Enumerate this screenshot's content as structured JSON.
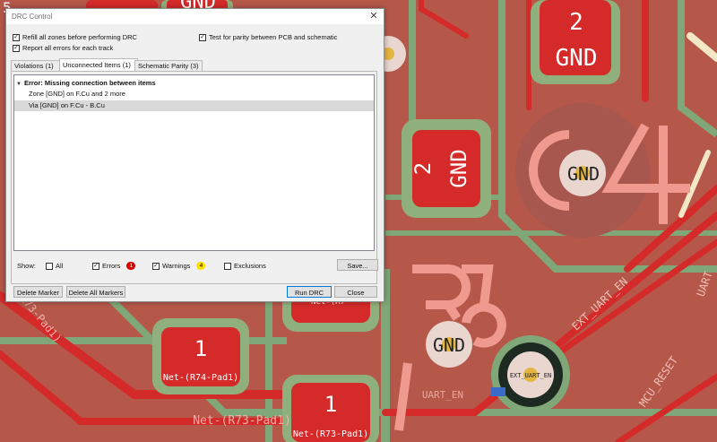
{
  "dialog": {
    "title": "DRC Control",
    "close_glyph": "✕",
    "options": {
      "refill_zones": {
        "label": "Refill all zones before performing DRC",
        "checked": true
      },
      "test_parity": {
        "label": "Test for parity between PCB and schematic",
        "checked": true
      },
      "report_all_errors": {
        "label": "Report all errors for each track",
        "checked": true
      }
    },
    "tabs": [
      {
        "label": "Violations (1)"
      },
      {
        "label": "Unconnected Items (1)"
      },
      {
        "label": "Schematic Parity (3)"
      }
    ],
    "list": {
      "header": "Error: Missing connection between items",
      "items": [
        {
          "text": "Zone [GND] on F.Cu and 2 more"
        },
        {
          "text": "Via [GND] on F.Cu - B.Cu"
        }
      ]
    },
    "show": {
      "label": "Show:",
      "all": {
        "label": "All",
        "checked": false
      },
      "errors": {
        "label": "Errors",
        "checked": true,
        "count": "1"
      },
      "warnings": {
        "label": "Warnings",
        "checked": true,
        "count": "4"
      },
      "exclusions": {
        "label": "Exclusions",
        "checked": false
      },
      "save_label": "Save..."
    },
    "buttons": {
      "delete_marker": "Delete Marker",
      "delete_all": "Delete All Markers",
      "run_drc": "Run DRC",
      "close": "Close"
    },
    "check_glyph": "✓"
  },
  "pcb": {
    "labels": {
      "pad_gnd_top_num": "2",
      "pad_gnd_top_net": "GND",
      "pad_gnd_mid_num": "2",
      "pad_gnd_mid_net": "GND",
      "top_gnd_partial": "GND",
      "via_gnd_1": "GND",
      "via_gnd_2": "GND",
      "silk_c4": "C4",
      "silk_r73": "R73",
      "pad_r74_num": "1",
      "pad_r74_net": "Net-(R74-Pad1)",
      "pad_r73_num": "1",
      "pad_r73_net": "Net-(R73-Pad1)",
      "trace_r73_net": "Net-(R73-Pad1)",
      "trace_r73_left": "(R73-Pad1)",
      "trace_uart_en": "UART_EN",
      "trace_ext_uart_en": "EXT_UART_EN",
      "via_ext_uart_en": "EXT_UART_EN",
      "trace_mcu_reset": "MCU_RESET",
      "trace_uart_right": "UART",
      "partial_net_top": "Net-(R7",
      "partial_left_top": "5"
    },
    "colors": {
      "board": "#b5584a",
      "zone_green": "#7fa777",
      "trace_red": "#d42a2a",
      "pad_red": "#d42a2a",
      "pad_outline": "#8fb07c",
      "silk": "#f0998f",
      "via_ring": "#e8d6cf",
      "via_drill": "#e4b640",
      "cream": "#f3e8c6"
    }
  }
}
